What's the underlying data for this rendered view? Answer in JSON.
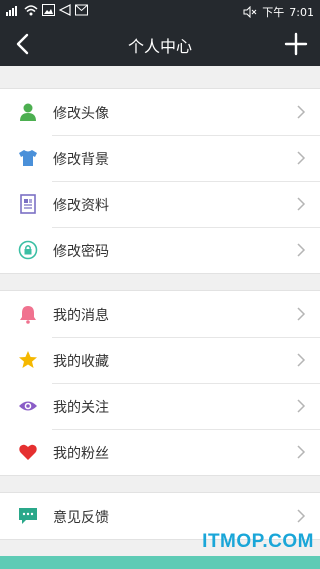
{
  "status": {
    "time_prefix": "下午",
    "time": "7:01"
  },
  "header": {
    "title": "个人中心",
    "back_icon": "chevron-left-icon",
    "add_icon": "plus-icon"
  },
  "groups": [
    {
      "items": [
        {
          "label": "修改头像",
          "icon": "user-icon",
          "color": "#4caf50"
        },
        {
          "label": "修改背景",
          "icon": "tshirt-icon",
          "color": "#4a90d9"
        },
        {
          "label": "修改资料",
          "icon": "document-icon",
          "color": "#7b6fc4"
        },
        {
          "label": "修改密码",
          "icon": "lock-icon",
          "color": "#3bbfa4"
        }
      ]
    },
    {
      "items": [
        {
          "label": "我的消息",
          "icon": "bell-icon",
          "color": "#f0728f"
        },
        {
          "label": "我的收藏",
          "icon": "star-icon",
          "color": "#f5b800"
        },
        {
          "label": "我的关注",
          "icon": "eye-icon",
          "color": "#8a5cc7"
        },
        {
          "label": "我的粉丝",
          "icon": "heart-icon",
          "color": "#e53030"
        }
      ]
    },
    {
      "items": [
        {
          "label": "意见反馈",
          "icon": "chat-icon",
          "color": "#2aa88a"
        }
      ]
    }
  ],
  "watermark": "ITMOP.COM",
  "colors": {
    "topbar": "#25292e",
    "accent_footer": "#5ecbb5"
  }
}
